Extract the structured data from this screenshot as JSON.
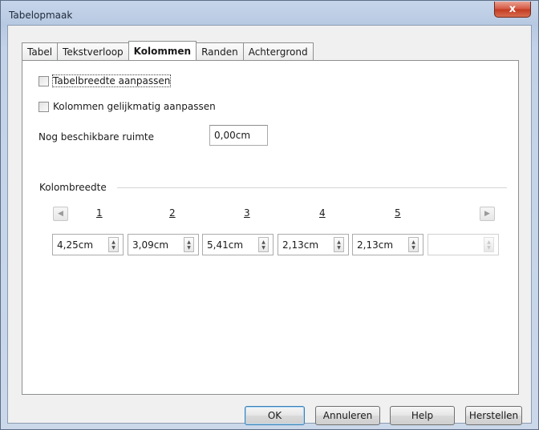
{
  "window": {
    "title": "Tabelopmaak",
    "close_label": "x"
  },
  "tabs": [
    {
      "label": "Tabel"
    },
    {
      "label": "Tekstverloop"
    },
    {
      "label": "Kolommen"
    },
    {
      "label": "Randen"
    },
    {
      "label": "Achtergrond"
    }
  ],
  "active_tab": "Kolommen",
  "options": {
    "fit_table_width": {
      "label": "Tabelbreedte aanpassen",
      "checked": false
    },
    "adapt_columns_evenly": {
      "label": "Kolommen gelijkmatig aanpassen",
      "checked": false
    }
  },
  "remaining_space": {
    "label": "Nog beschikbare ruimte",
    "value": "0,00cm"
  },
  "column_width": {
    "section_label": "Kolombreedte",
    "columns": [
      {
        "number": "1",
        "value": "4,25cm"
      },
      {
        "number": "2",
        "value": "3,09cm"
      },
      {
        "number": "3",
        "value": "5,41cm"
      },
      {
        "number": "4",
        "value": "2,13cm"
      },
      {
        "number": "5",
        "value": "2,13cm"
      },
      {
        "number": "",
        "value": ""
      }
    ],
    "prev_icon": "arrow-left-icon",
    "next_icon": "arrow-right-icon"
  },
  "buttons": {
    "ok": "OK",
    "cancel": "Annuleren",
    "help": "Help",
    "reset": "Herstellen"
  }
}
